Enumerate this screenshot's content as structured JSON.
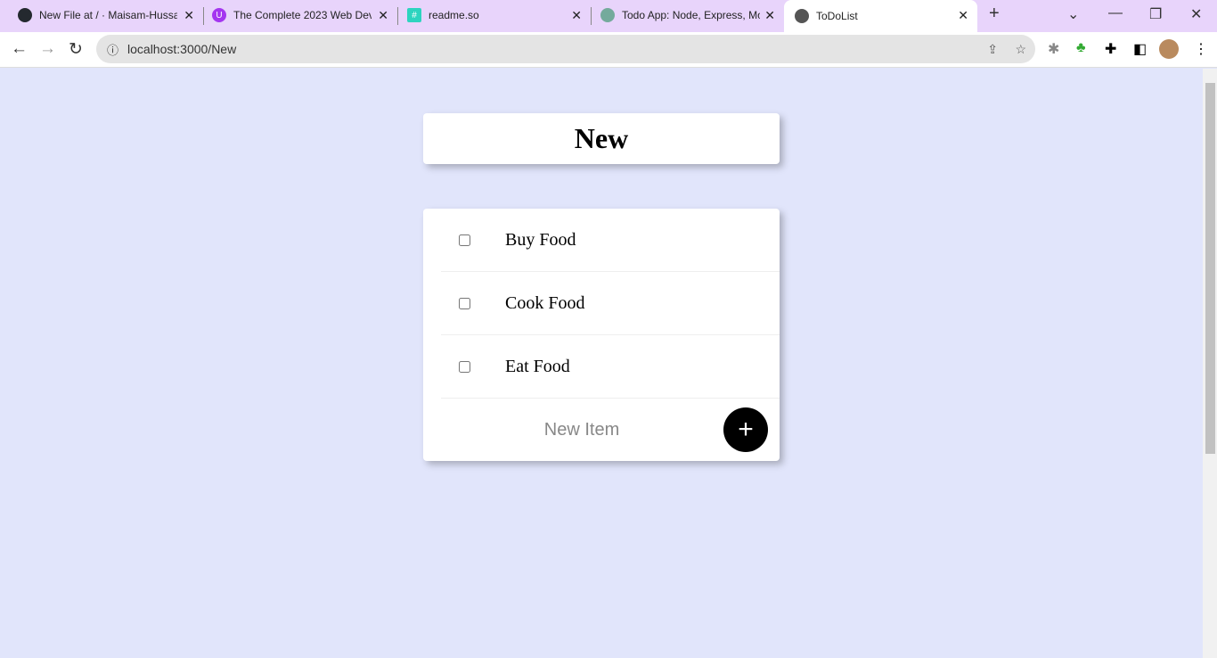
{
  "browser": {
    "tabs": [
      {
        "title": "New File at / · Maisam-Hussa",
        "icon": "github-icon",
        "color": "#24292f"
      },
      {
        "title": "The Complete 2023 Web Dev",
        "icon": "udemy-icon",
        "color": "#a435f0"
      },
      {
        "title": "readme.so",
        "icon": "readme-icon",
        "color": "#2dd4bf"
      },
      {
        "title": "Todo App: Node, Express, Mo",
        "icon": "chatgpt-icon",
        "color": "#74aa9c"
      },
      {
        "title": "ToDoList",
        "icon": "globe-icon",
        "color": "#555"
      }
    ],
    "url": "localhost:3000/New"
  },
  "page": {
    "title": "New",
    "items": [
      "Buy Food",
      "Cook Food",
      "Eat Food"
    ],
    "new_item_placeholder": "New Item",
    "add_label": "+"
  }
}
